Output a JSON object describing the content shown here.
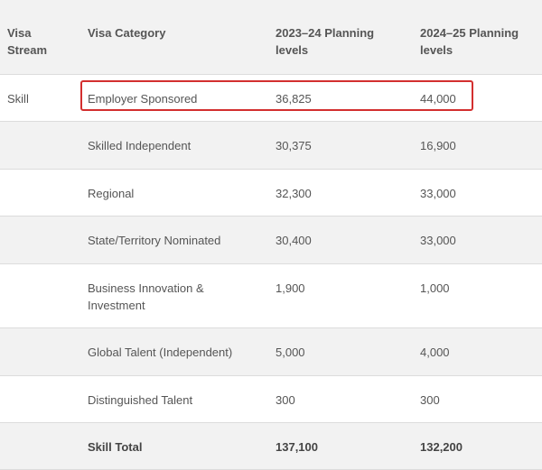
{
  "table": {
    "headers": [
      "Visa Stream",
      "Visa Category",
      "2023–24 Planning levels",
      "2024–25 Planning levels"
    ],
    "rows": [
      {
        "stream": "Skill",
        "category": "Employer Sponsored",
        "y2324": "36,825",
        "y2425": "44,000"
      },
      {
        "stream": "",
        "category": "Skilled Independent",
        "y2324": "30,375",
        "y2425": "16,900"
      },
      {
        "stream": "",
        "category": "Regional",
        "y2324": "32,300",
        "y2425": "33,000"
      },
      {
        "stream": "",
        "category": "State/Territory Nominated",
        "y2324": "30,400",
        "y2425": "33,000"
      },
      {
        "stream": "",
        "category": "Business Innovation & Investment",
        "y2324": "1,900",
        "y2425": "1,000"
      },
      {
        "stream": "",
        "category": "Global Talent (Independent)",
        "y2324": "5,000",
        "y2425": "4,000"
      },
      {
        "stream": "",
        "category": "Distinguished Talent",
        "y2324": "300",
        "y2425": "300"
      }
    ],
    "total": {
      "stream": "",
      "category": "Skill Total",
      "y2324": "137,100",
      "y2425": "132,200"
    }
  },
  "colors": {
    "highlight_border": "#d32f2f",
    "stripe": "#f2f2f2"
  }
}
